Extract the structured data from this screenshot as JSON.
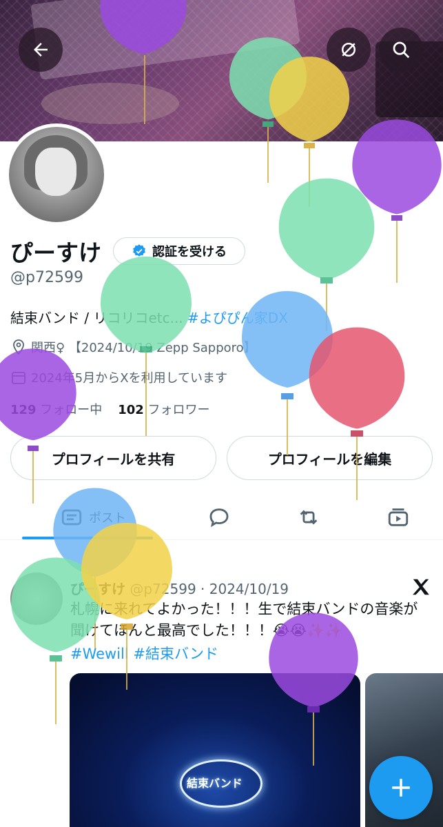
{
  "profile": {
    "name": "ぴーすけ",
    "handle": "@p72599",
    "verify_label": "認証を受ける",
    "bio_text": "結束バンド / リコリコetc... ",
    "bio_hashtag": "#よぴぴん家DX",
    "location": "関西♀ 【2024/10/19 Zepp Sapporo】",
    "joined": "2024年5月からXを利用しています",
    "following_count": "129",
    "following_label": "フォロー中",
    "followers_count": "102",
    "followers_label": "フォロワー"
  },
  "actions": {
    "share_label": "プロフィールを共有",
    "edit_label": "プロフィールを編集"
  },
  "tabs": {
    "posts_label": "ポスト"
  },
  "post": {
    "author": "ぴーすけ",
    "handle_date": "@p72599 · 2024/10/19",
    "text": "札幌に来れてよかった！！！生で結束バンドの音楽が聞けてほんと最高でした！！！😭😭✨✨",
    "hashtags": "#Wewill #結束バンド",
    "media_neon_text": "結束バンド"
  },
  "colors": {
    "accent": "#1d9bf0",
    "balloon_green": "#7ce0b0",
    "balloon_yellow": "#f2d24a",
    "balloon_purple": "#9b4be0",
    "balloon_blue": "#6fb6f5",
    "balloon_red": "#e5566f"
  },
  "icons": [
    "back-arrow-icon",
    "no-signal-icon",
    "search-icon",
    "verified-badge-icon",
    "location-icon",
    "calendar-icon",
    "posts-tab-icon",
    "replies-tab-icon",
    "reposts-tab-icon",
    "media-tab-icon",
    "x-logo-icon",
    "plus-icon"
  ]
}
